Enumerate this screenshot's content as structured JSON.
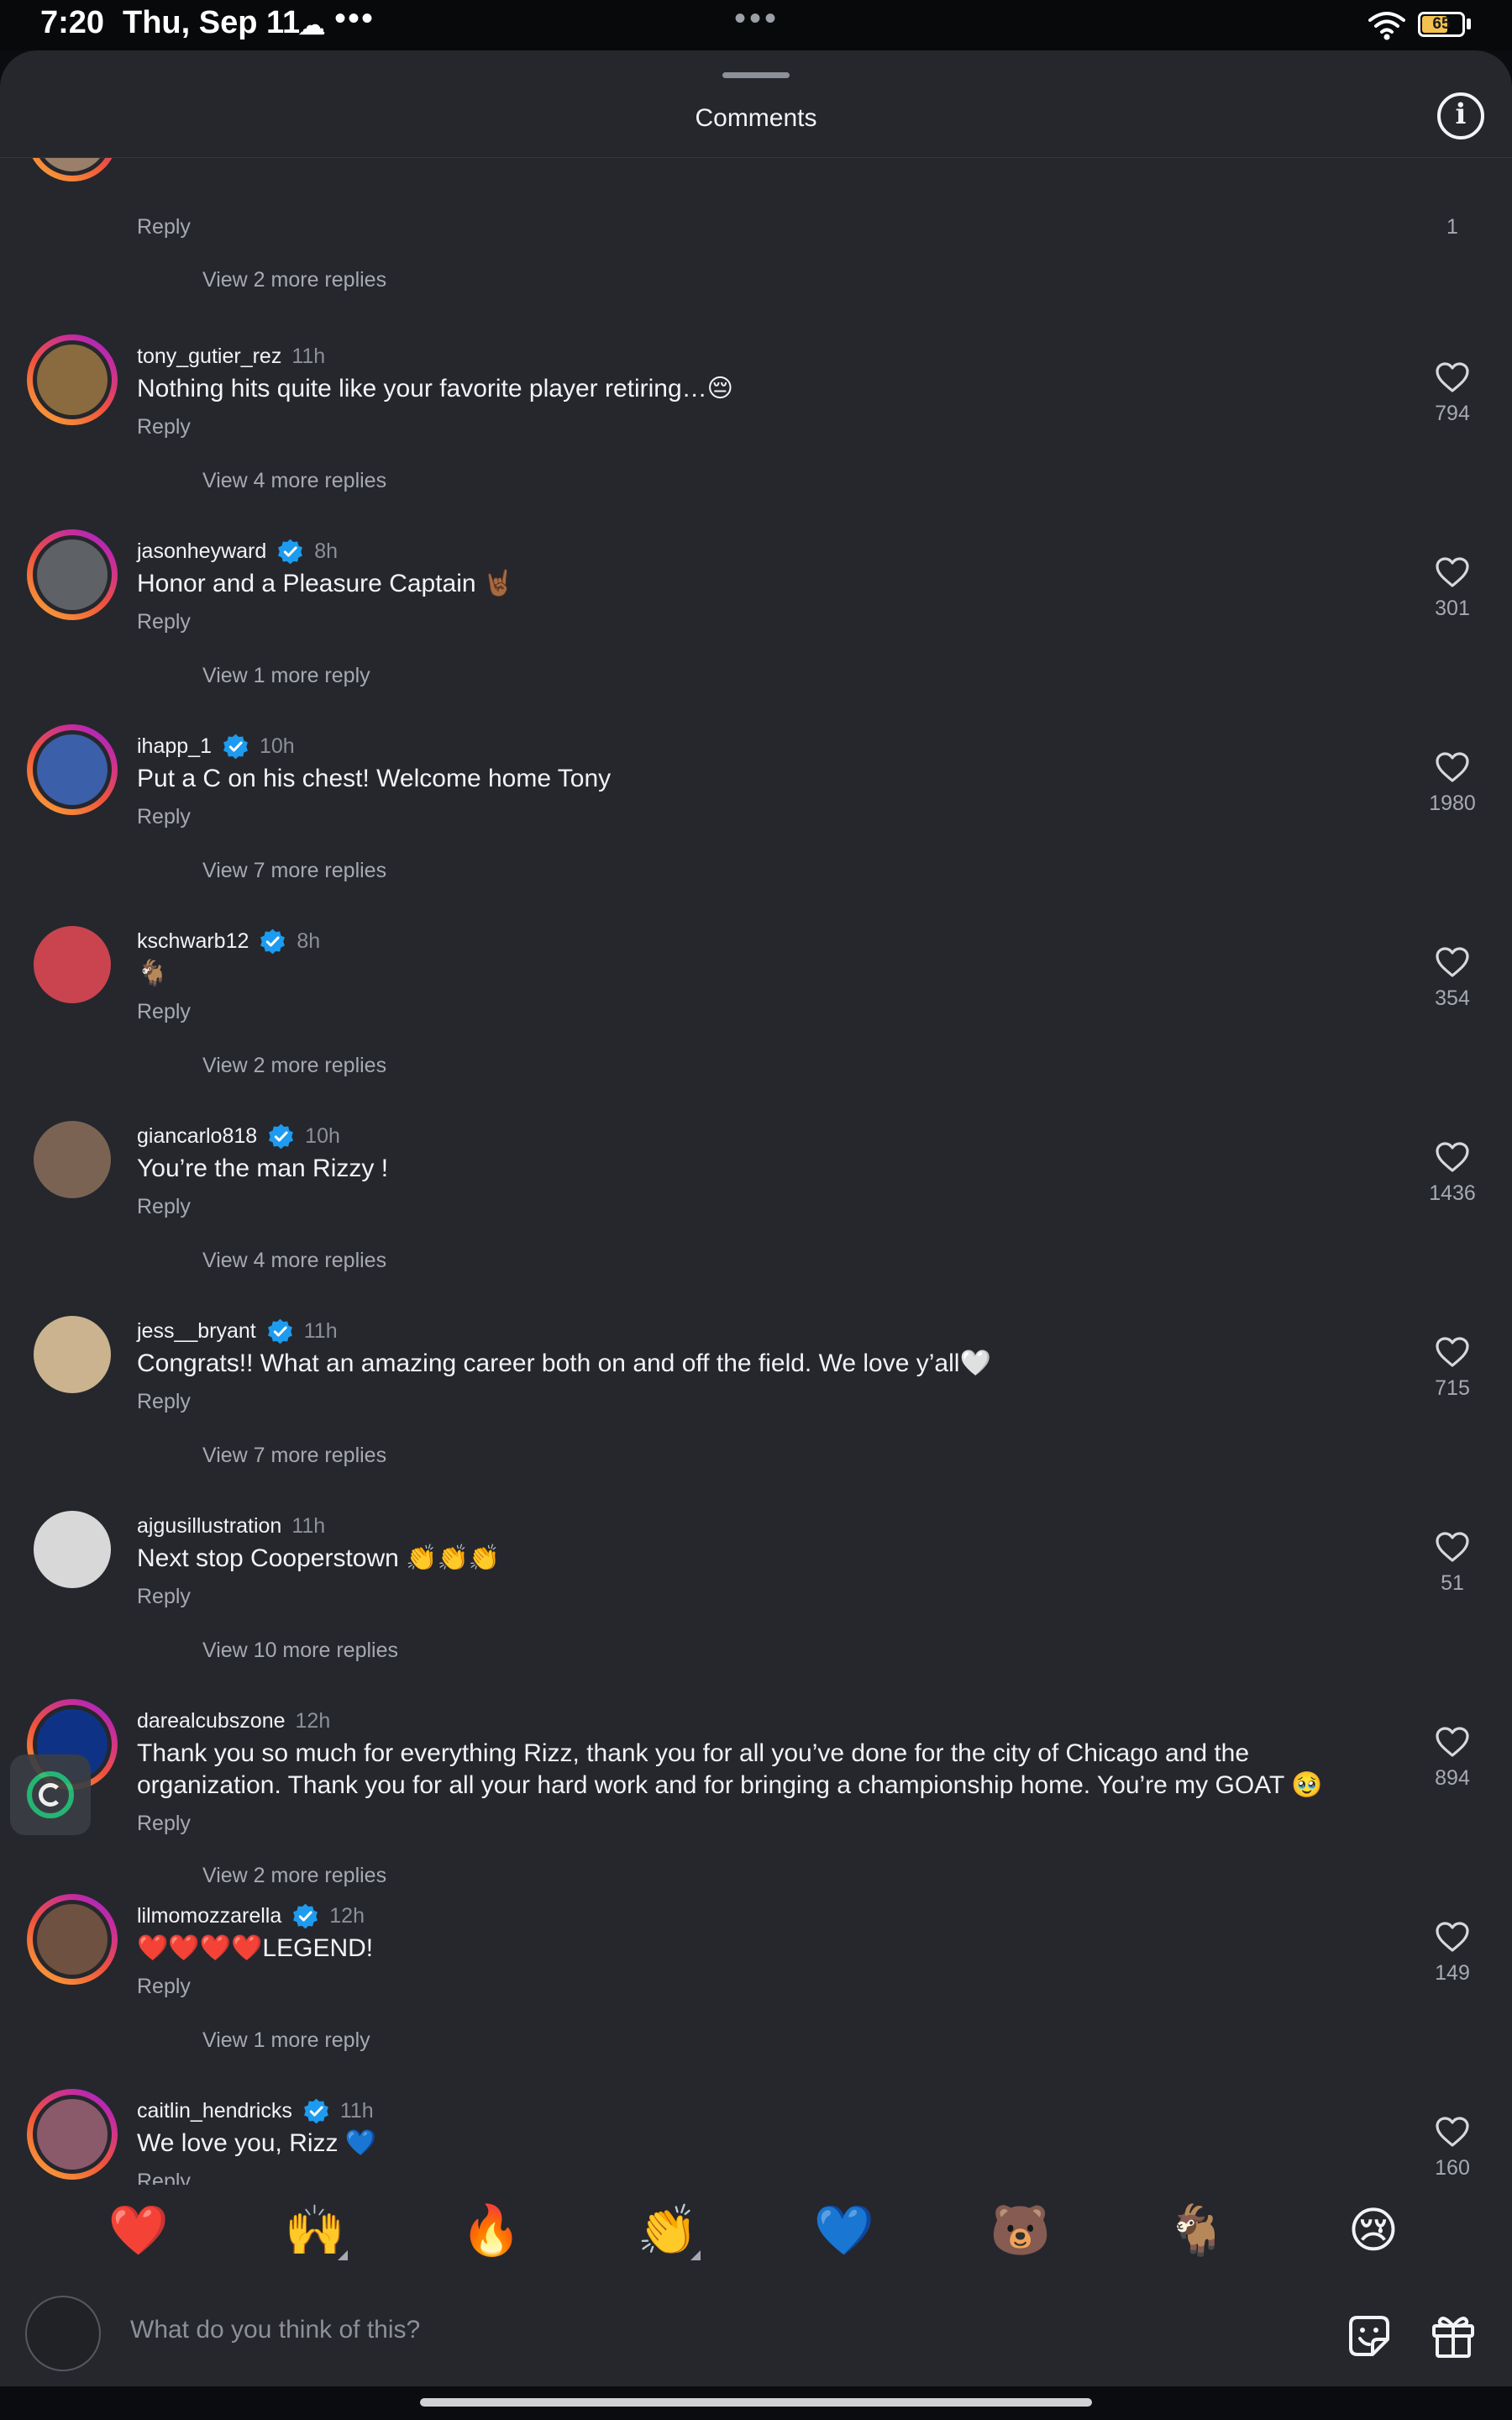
{
  "status_bar": {
    "time": "7:20",
    "date": "Thu, Sep 11",
    "battery": "65",
    "battery_level": 0.65
  },
  "header": {
    "title": "Comments"
  },
  "top_partial": {
    "reply_label": "Reply",
    "like_count": "1",
    "view_replies": "View 2 more replies"
  },
  "comments": [
    {
      "username": "tony_gutier_rez",
      "verified": false,
      "time": "11h",
      "text": "Nothing hits quite like your favorite player retiring…😔",
      "reply_label": "Reply",
      "likes": "794",
      "view_replies": "View 4 more replies",
      "ring": true,
      "avatar_bg": "#8a6b3f"
    },
    {
      "username": "jasonheyward",
      "verified": true,
      "time": "8h",
      "text": "Honor and a Pleasure Captain 🤘🏾",
      "reply_label": "Reply",
      "likes": "301",
      "view_replies": "View 1 more reply",
      "ring": true,
      "avatar_bg": "#5e6166"
    },
    {
      "username": "ihapp_1",
      "verified": true,
      "time": "10h",
      "text": "Put a C on his chest! Welcome home Tony",
      "reply_label": "Reply",
      "likes": "1980",
      "view_replies": "View 7 more replies",
      "ring": true,
      "avatar_bg": "#3b5fa8"
    },
    {
      "username": "kschwarb12",
      "verified": true,
      "time": "8h",
      "text": "🐐",
      "reply_label": "Reply",
      "likes": "354",
      "view_replies": "View 2 more replies",
      "ring": false,
      "avatar_bg": "#c9444e"
    },
    {
      "username": "giancarlo818",
      "verified": true,
      "time": "10h",
      "text": "You’re the man Rizzy !",
      "reply_label": "Reply",
      "likes": "1436",
      "view_replies": "View 4 more replies",
      "ring": false,
      "avatar_bg": "#7b6353"
    },
    {
      "username": "jess__bryant",
      "verified": true,
      "time": "11h",
      "text": "Congrats!! What an amazing career both on and off the field. We love y’all🤍",
      "reply_label": "Reply",
      "likes": "715",
      "view_replies": "View 7 more replies",
      "ring": false,
      "avatar_bg": "#cbb38f"
    },
    {
      "username": "ajgusillustration",
      "verified": false,
      "time": "11h",
      "text": "Next stop Cooperstown 👏👏👏",
      "reply_label": "Reply",
      "likes": "51",
      "view_replies": "View 10 more replies",
      "ring": false,
      "avatar_bg": "#d8d8d8"
    },
    {
      "username": "darealcubszone",
      "verified": false,
      "time": "12h",
      "text": "Thank you so much for everything Rizz, thank you for all you’ve done for the city of Chicago and the organization. Thank you for all your hard work and for bringing a championship home. You’re my GOAT 🥹",
      "reply_label": "Reply",
      "likes": "894",
      "view_replies": "View 2 more replies",
      "ring": true,
      "avatar_bg": "#0e3386"
    },
    {
      "username": "lilmomozzarella",
      "verified": true,
      "time": "12h",
      "text": "❤️❤️❤️❤️LEGEND!",
      "reply_label": "Reply",
      "likes": "149",
      "view_replies": "View 1 more reply",
      "ring": true,
      "avatar_bg": "#6e5140"
    },
    {
      "username": "caitlin_hendricks",
      "verified": true,
      "time": "11h",
      "text": "We love you, Rizz 💙",
      "reply_label": "Reply",
      "likes": "160",
      "view_replies": "",
      "ring": true,
      "avatar_bg": "#8a5a6a"
    }
  ],
  "emoji_bar": [
    {
      "emoji": "❤️",
      "name": "heart",
      "more": false
    },
    {
      "emoji": "🙌",
      "name": "raised-hands",
      "more": true
    },
    {
      "emoji": "🔥",
      "name": "fire",
      "more": false
    },
    {
      "emoji": "👏",
      "name": "clapping-hands",
      "more": true
    },
    {
      "emoji": "💙",
      "name": "blue-heart",
      "more": false
    },
    {
      "emoji": "🐻",
      "name": "bear",
      "more": false
    },
    {
      "emoji": "🐐",
      "name": "goat",
      "more": false
    },
    {
      "emoji": "😢",
      "name": "crying-face",
      "more": false
    }
  ],
  "composer": {
    "placeholder": "What do you think of this?"
  },
  "colors": {
    "sheet_bg": "#25272d",
    "verified_blue": "#1d9bf0",
    "secondary_text": "#a6aab0"
  }
}
